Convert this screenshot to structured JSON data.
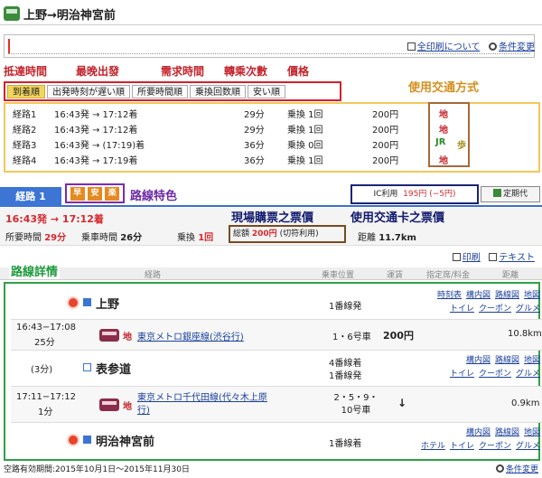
{
  "title": "上野→明治神宮前",
  "search_tools": {
    "print_all": "全印刷について",
    "change": "条件変更"
  },
  "annotations": {
    "arrival_time": "抵達時間",
    "latest_departure": "最晚出發",
    "required_time": "需求時間",
    "transfers": "轉乘次數",
    "price": "價格",
    "transport_mode": "使用交通方式",
    "route_features": "路線特色",
    "onsite_ticket": "現場購票之票價",
    "ic_ticket": "使用交通卡之票價",
    "route_details": "路線詳情"
  },
  "sort_tabs": [
    "到着順",
    "出発時刻が遅い順",
    "所要時間順",
    "乗換回数順",
    "安い順"
  ],
  "routes": [
    {
      "name": "経路1",
      "time": "16:43発 → 17:12着",
      "duration": "29分",
      "transfer": "乗換 1回",
      "fare": "200円",
      "modes": [
        "地"
      ]
    },
    {
      "name": "経路2",
      "time": "16:43発 → 17:12着",
      "duration": "29分",
      "transfer": "乗換 1回",
      "fare": "200円",
      "modes": [
        "地"
      ]
    },
    {
      "name": "経路3",
      "time": "16:43発 → (17:19)着",
      "duration": "36分",
      "transfer": "乗換 0回",
      "fare": "200円",
      "modes": [
        "JR",
        "歩"
      ]
    },
    {
      "name": "経路4",
      "time": "16:43発 → 17:19着",
      "duration": "36分",
      "transfer": "乗換 1回",
      "fare": "200円",
      "modes": [
        "地"
      ]
    }
  ],
  "route_tab": "経路 1",
  "features": [
    "早",
    "安",
    "楽"
  ],
  "ic_fare": {
    "label": "IC利用",
    "value": "195円 (−5円)"
  },
  "commuter_pass": "定期代",
  "summary": {
    "time_dep": "16:43発",
    "time_arr": "17:12着",
    "arrow": "→",
    "required_label": "所要時間",
    "required_value": "29分",
    "ride_label": "乗車時間",
    "ride_value": "26分",
    "transfer_label": "乗換",
    "transfer_value": "1回",
    "fare_label": "総額",
    "fare_value": "200円",
    "fare_note": "(切符利用)",
    "distance_label": "距離",
    "distance_value": "11.7km"
  },
  "print_links": {
    "print": "印刷",
    "text": "テキスト"
  },
  "table_header": {
    "route": "経路",
    "car": "乗車位置",
    "fare": "運賃",
    "seat": "指定席/料金",
    "distance": "距離"
  },
  "details": {
    "st1": {
      "name": "上野",
      "platform": "1番線発",
      "links1": [
        "時刻表",
        "構内図",
        "路線図",
        "地図"
      ],
      "links2": [
        "トイレ",
        "クーポン",
        "グルメ"
      ]
    },
    "seg1": {
      "time": "16:43−17:08",
      "dur": "25分",
      "mode": "地",
      "line": "東京メトロ銀座線(渋谷行)",
      "car": "1・6号車",
      "fare": "200円",
      "distance": "10.8km"
    },
    "st2": {
      "wait": "(3分)",
      "name": "表参道",
      "platform1": "4番線着",
      "platform2": "1番線発",
      "links1": [
        "構内図",
        "路線図",
        "地図"
      ],
      "links2": [
        "トイレ",
        "クーポン",
        "グルメ"
      ]
    },
    "seg2": {
      "time": "17:11−17:12",
      "dur": "1分",
      "mode": "地",
      "line": "東京メトロ千代田線(代々木上原行)",
      "car": "2・5・9・10号車",
      "fare": "↓",
      "distance": "0.9km"
    },
    "st3": {
      "name": "明治神宮前",
      "platform": "1番線着",
      "links1": [
        "構内図",
        "路線図",
        "地図"
      ],
      "links2": [
        "ホテル",
        "トイレ",
        "クーポン",
        "グルメ"
      ]
    }
  },
  "footer": {
    "validity": "空路有効期間:2015年10月1日〜2015年11月30日",
    "change": "条件変更"
  }
}
